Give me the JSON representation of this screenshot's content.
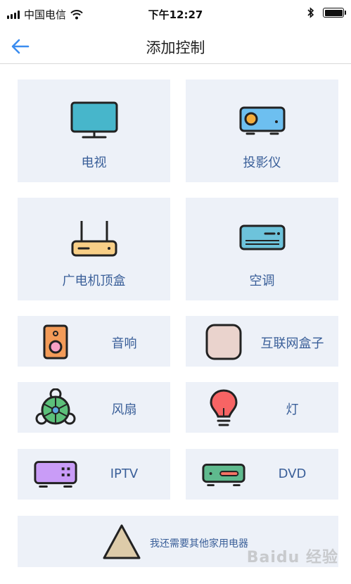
{
  "status_bar": {
    "carrier": "中国电信",
    "time": "下午12:27",
    "icons": [
      "signal-icon",
      "wifi-icon",
      "bluetooth-icon",
      "battery-icon"
    ]
  },
  "nav": {
    "back_icon": "back-arrow-icon",
    "title": "添加控制"
  },
  "devices": [
    {
      "label": "电视",
      "icon": "tv-icon"
    },
    {
      "label": "投影仪",
      "icon": "projector-icon"
    },
    {
      "label": "广电机顶盒",
      "icon": "set-top-box-icon"
    },
    {
      "label": "空调",
      "icon": "air-conditioner-icon"
    },
    {
      "label": "音响",
      "icon": "speaker-icon"
    },
    {
      "label": "互联网盒子",
      "icon": "internet-box-icon"
    },
    {
      "label": "风扇",
      "icon": "fan-icon"
    },
    {
      "label": "灯",
      "icon": "light-bulb-icon"
    },
    {
      "label": "IPTV",
      "icon": "iptv-icon"
    },
    {
      "label": "DVD",
      "icon": "dvd-icon"
    }
  ],
  "other": {
    "label": "我还需要其他家用电器",
    "icon": "triangle-icon"
  },
  "watermark": "Baidu 经验",
  "colors": {
    "tile_bg": "#edf1f8",
    "label": "#3a5f99",
    "accent": "#3b8df0"
  }
}
